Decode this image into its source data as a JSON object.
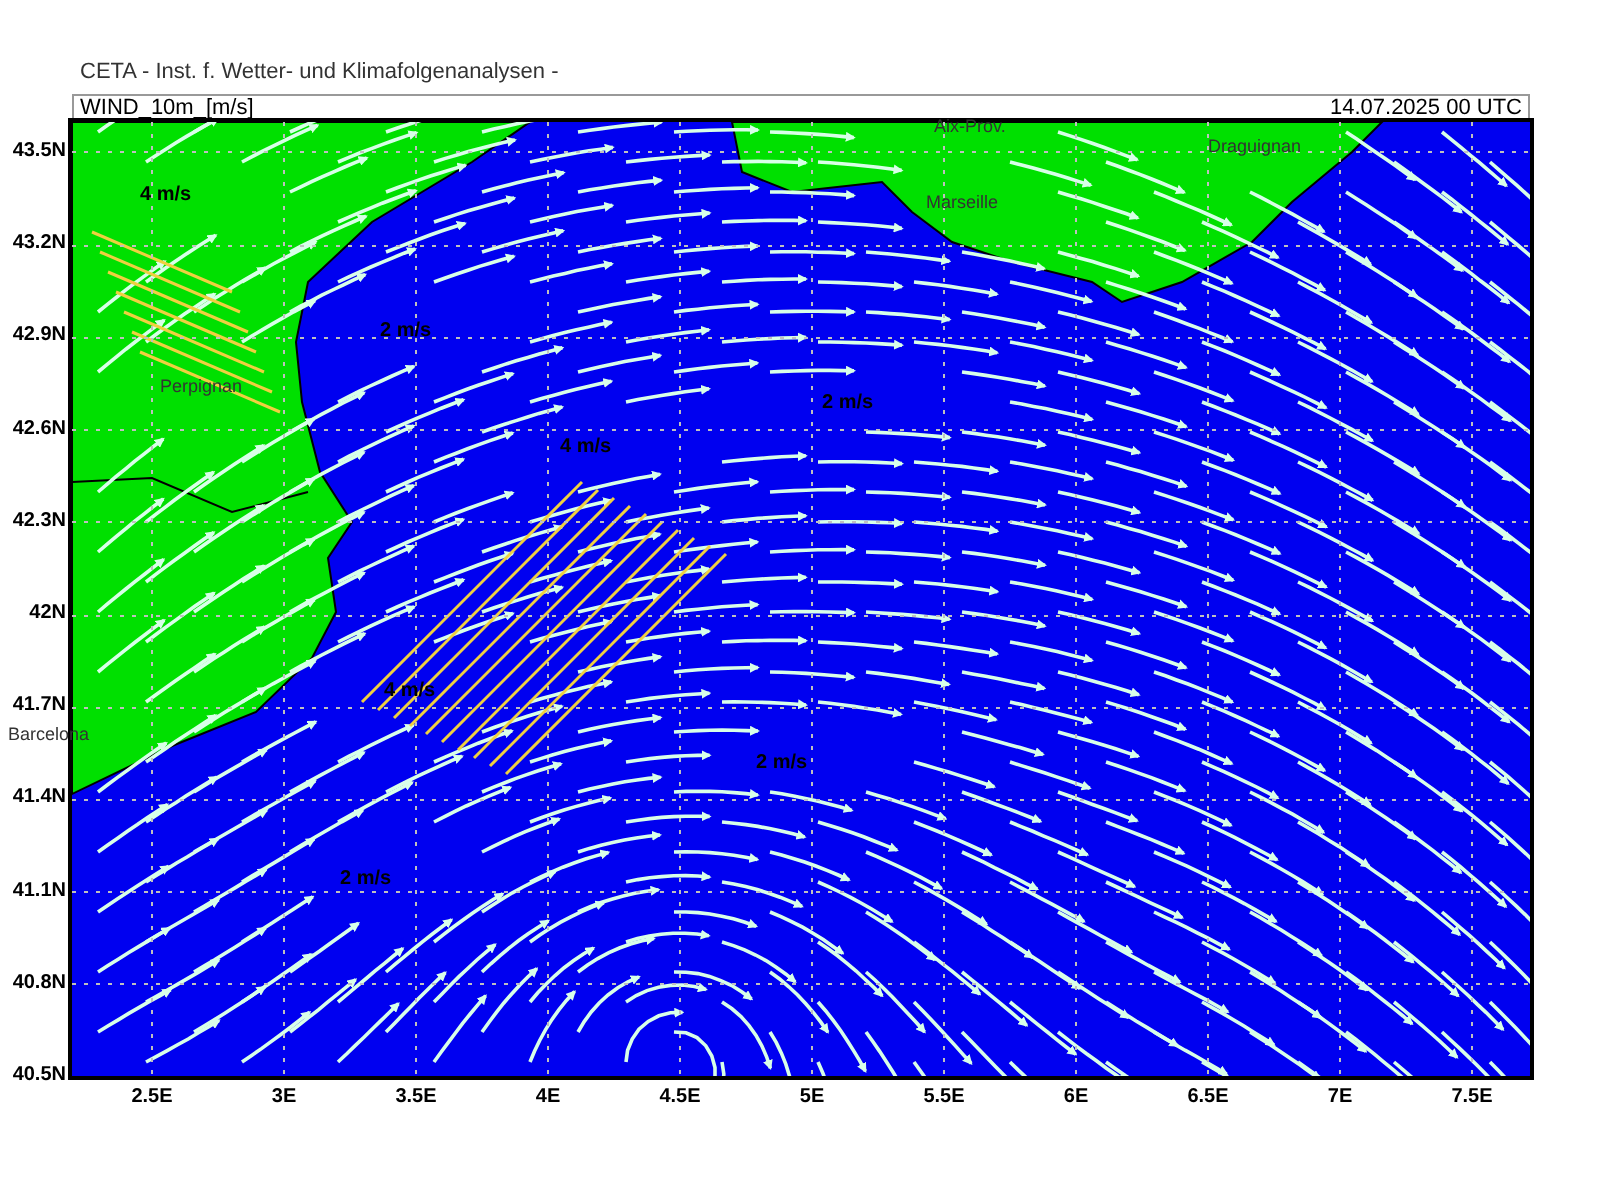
{
  "header": "CETA - Inst. f. Wetter- und Klimafolgenanalysen -",
  "plot": {
    "variable": "WIND_10m_[m/s]",
    "valid_time": "14.07.2025 00 UTC"
  },
  "map_labels": [
    {
      "kind": "speed",
      "text": "4 m/s"
    },
    {
      "kind": "city",
      "text": "Perpignan"
    },
    {
      "kind": "speed",
      "text": "2 m/s"
    },
    {
      "kind": "speed",
      "text": "4 m/s"
    },
    {
      "kind": "speed",
      "text": "4 m/s"
    },
    {
      "kind": "city",
      "text": "Barcelona"
    },
    {
      "kind": "city",
      "text": "Aix-Prov."
    },
    {
      "kind": "city",
      "text": "Draguignan"
    },
    {
      "kind": "city",
      "text": "Marseille"
    },
    {
      "kind": "speed",
      "text": "2 m/s"
    },
    {
      "kind": "speed",
      "text": "2 m/s"
    },
    {
      "kind": "speed",
      "text": "2 m/s"
    }
  ],
  "y_ticks": [
    "43.5N",
    "43.2N",
    "42.9N",
    "42.6N",
    "42.3N",
    "42N",
    "41.7N",
    "41.4N",
    "41.1N",
    "40.8N",
    "40.5N"
  ],
  "x_ticks": [
    "2.5E",
    "3E",
    "3.5E",
    "4E",
    "4.5E",
    "5E",
    "5.5E",
    "6E",
    "6.5E",
    "7E",
    "7.5E"
  ]
}
